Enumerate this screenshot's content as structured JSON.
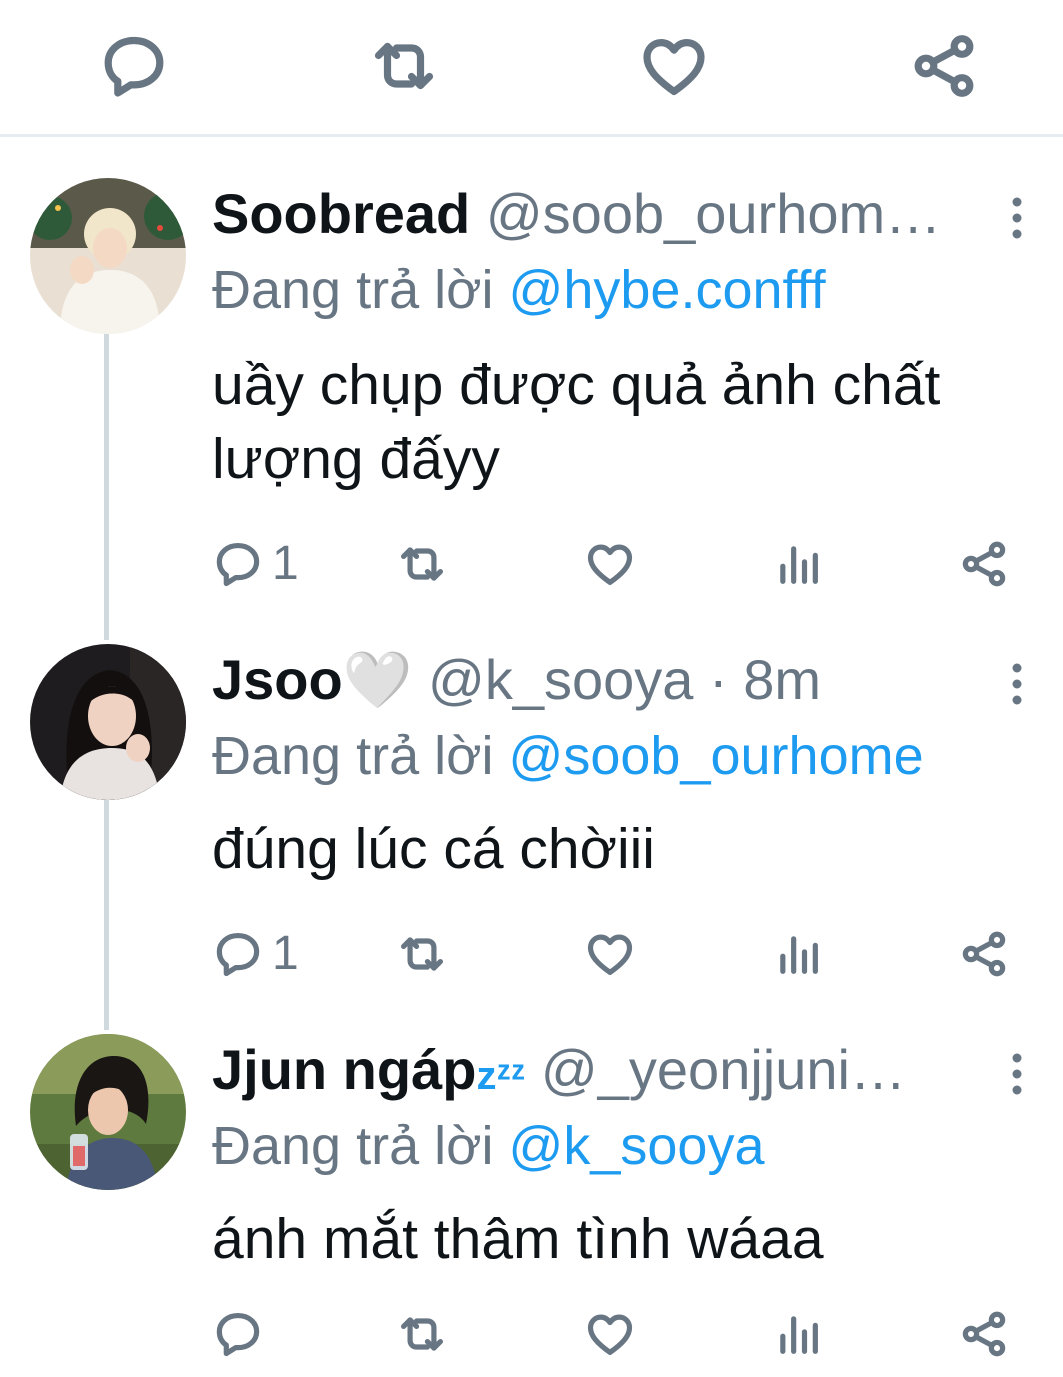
{
  "top_actions": {
    "reply_icon": "reply-icon",
    "retweet_icon": "retweet-icon",
    "like_icon": "heart-icon",
    "share_icon": "share-icon"
  },
  "tweets": [
    {
      "display_name": "Soobread",
      "handle": "@soob_ourhom…",
      "time": "",
      "reply_prefix": "Đang trả lời",
      "reply_to": "@hybe.confff",
      "text": "uầy chụp được quả ảnh chất lượng đấyy",
      "reply_count": "1"
    },
    {
      "display_name": "Jsoo🤍",
      "handle": "@k_sooya",
      "time": "· 8m",
      "reply_prefix": "Đang trả lời",
      "reply_to": "@soob_ourhome",
      "text": "đúng lúc cá chờiii",
      "reply_count": "1"
    },
    {
      "display_name": "Jjun ngáp",
      "name_suffix": "zᶻᶻ",
      "handle": "@_yeonjjuni…",
      "time": "",
      "reply_prefix": "Đang trả lời",
      "reply_to": "@k_sooya",
      "text": "ánh mắt thâm tình wáaa",
      "reply_count": ""
    }
  ],
  "colors": {
    "accent": "#1d9bf0",
    "secondary_text": "#687684",
    "primary_text": "#0f1419",
    "thread_line": "#cfd9de"
  }
}
